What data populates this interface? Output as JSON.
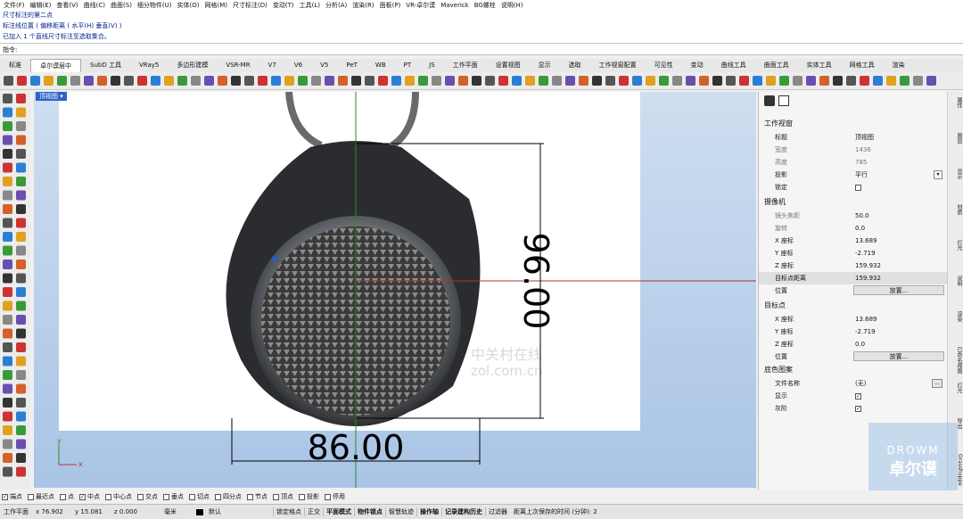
{
  "menu": [
    "文件(F)",
    "编辑(E)",
    "查看(V)",
    "曲线(C)",
    "曲面(S)",
    "细分物件(U)",
    "实体(O)",
    "网格(M)",
    "尺寸标注(D)",
    "变动(T)",
    "工具(L)",
    "分析(A)",
    "渲染(R)",
    "面板(P)",
    "VR-卓尔谟",
    "Maverick",
    "BG螺栓",
    "说明(H)"
  ],
  "command_history": [
    "尺寸标注的第二点",
    "标注线位置 ( 偏移距离 ( 水平(H)  垂直(V) )",
    "已加入 1 个直线尺寸标注至选取集合。"
  ],
  "command_prompt": "指令:",
  "tabs": [
    "标准",
    "卓尔谟层中",
    "SubD 工具",
    "VRay5",
    "多边形建模",
    "VSR-MR",
    "V7",
    "V6",
    "V5",
    "PeT",
    "WB",
    "PT",
    "JS",
    "工作平面",
    "设置视图",
    "显示",
    "选取",
    "工作视窗配置",
    "可见性",
    "变动",
    "曲线工具",
    "曲面工具",
    "实体工具",
    "网格工具",
    "渲染"
  ],
  "active_tab": "卓尔谟层中",
  "viewport": {
    "label": "顶视图",
    "dim_horizontal": "86.00",
    "dim_vertical": "96.00",
    "watermark_line1": "中关村在线",
    "watermark_line2": "zol.com.cn",
    "axis_x": "x",
    "axis_y": "y"
  },
  "panel": {
    "side_tabs": [
      "属性",
      "图层",
      "显示",
      "材质",
      "灯光",
      "说明",
      "渲染",
      "已命名视图",
      "灯光",
      "导出",
      "Grasshopper"
    ],
    "section_viewport": "工作视窗",
    "title_key": "标题",
    "title_val": "顶视图",
    "width_key": "宽度",
    "width_val": "1436",
    "height_key": "高度",
    "height_val": "785",
    "proj_key": "投影",
    "proj_val": "平行",
    "lock_key": "锁定",
    "section_camera": "摄像机",
    "lens_key": "镜头焦距",
    "lens_val": "50.0",
    "rot_key": "旋转",
    "rot_val": "0.0",
    "cx_key": "X 座标",
    "cx_val": "13.689",
    "cy_key": "Y 座标",
    "cy_val": "-2.719",
    "cz_key": "Z 座标",
    "cz_val": "159.932",
    "tdist_key": "目标点距离",
    "tdist_val": "159.932",
    "pos_key": "位置",
    "place_btn": "放置...",
    "section_target": "目标点",
    "tx_key": "X 座标",
    "tx_val": "13.689",
    "ty_key": "Y 座标",
    "ty_val": "-2.719",
    "tz_key": "Z 座标",
    "tz_val": "0.0",
    "tpos_key": "位置",
    "tplace_btn": "放置...",
    "section_bg": "底色图案",
    "file_key": "文件名称",
    "file_val": "(无)",
    "file_btn": "...",
    "show_key": "显示",
    "gray_key": "灰阶"
  },
  "snaps": [
    {
      "label": "端点",
      "checked": true
    },
    {
      "label": "最近点",
      "checked": false
    },
    {
      "label": "点",
      "checked": false
    },
    {
      "label": "中点",
      "checked": true
    },
    {
      "label": "中心点",
      "checked": false
    },
    {
      "label": "交点",
      "checked": false
    },
    {
      "label": "垂点",
      "checked": false
    },
    {
      "label": "切点",
      "checked": false
    },
    {
      "label": "四分点",
      "checked": false
    },
    {
      "label": "节点",
      "checked": false
    },
    {
      "label": "顶点",
      "checked": false
    },
    {
      "label": "投影",
      "checked": false
    },
    {
      "label": "停用",
      "checked": false
    }
  ],
  "status": {
    "plane": "工作平面",
    "x": "x 76.902",
    "y": "y 15.081",
    "z": "z 0.000",
    "unit": "毫米",
    "layer": "默认",
    "items": [
      "锁定格点",
      "正交",
      "平面模式",
      "物件锁点",
      "智慧轨迹",
      "操作轴",
      "记录建构历史",
      "过滤器"
    ],
    "autosave": "距离上次保存的时间 (分钟): 2"
  },
  "logo": {
    "top": "DROWM",
    "bottom": "卓尔谟"
  }
}
